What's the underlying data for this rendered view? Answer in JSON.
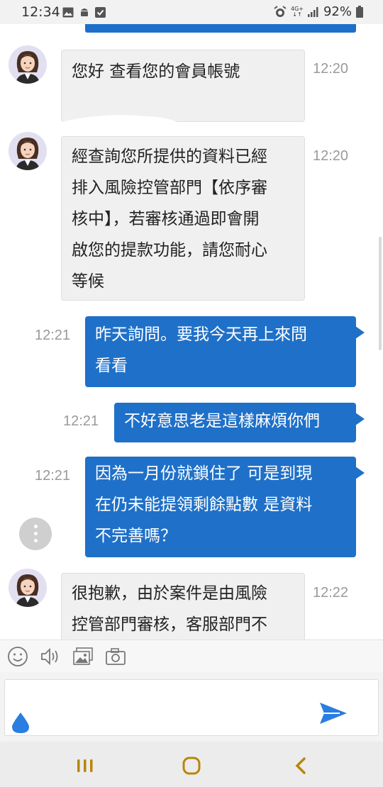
{
  "status_bar": {
    "time": "12:34",
    "network_top": "4G+",
    "network_bottom": "↓↑",
    "battery": "92%"
  },
  "colors": {
    "outgoing_bubble": "#1f70c8",
    "incoming_bubble": "#f0f0f0",
    "timestamp": "#9a9a9a",
    "send_icon": "#2a7de1"
  },
  "messages": [
    {
      "direction": "incoming",
      "text": "您好 查看您的會員帳號",
      "time": "12:20"
    },
    {
      "direction": "incoming",
      "lines": [
        "經查詢您所提供的資料已經",
        "排入風險控管部門【依序審",
        "核中】，若審核通過即會開",
        "啟您的提款功能，請您耐心",
        "等候"
      ],
      "time": "12:20"
    },
    {
      "direction": "outgoing",
      "lines": [
        "昨天詢問。要我今天再上來問",
        "看看"
      ],
      "time": "12:21"
    },
    {
      "direction": "outgoing",
      "text": "不好意思老是這樣麻煩你們",
      "time": "12:21"
    },
    {
      "direction": "outgoing",
      "lines": [
        "因為一月份就鎖住了 可是到現",
        "在仍未能提領剩餘點數 是資料",
        "不完善嗎？"
      ],
      "time": "12:21"
    },
    {
      "direction": "incoming",
      "lines": [
        "很抱歉，由於案件是由風險",
        "控管部門審核，客服部門不"
      ],
      "time": "12:22"
    }
  ],
  "toolbar": {
    "icons": [
      "emoji-icon",
      "voice-icon",
      "image-icon",
      "camera-icon"
    ]
  },
  "input": {
    "value": ""
  },
  "navbar": {
    "icons": [
      "recent-apps-icon",
      "home-icon",
      "back-icon"
    ]
  }
}
